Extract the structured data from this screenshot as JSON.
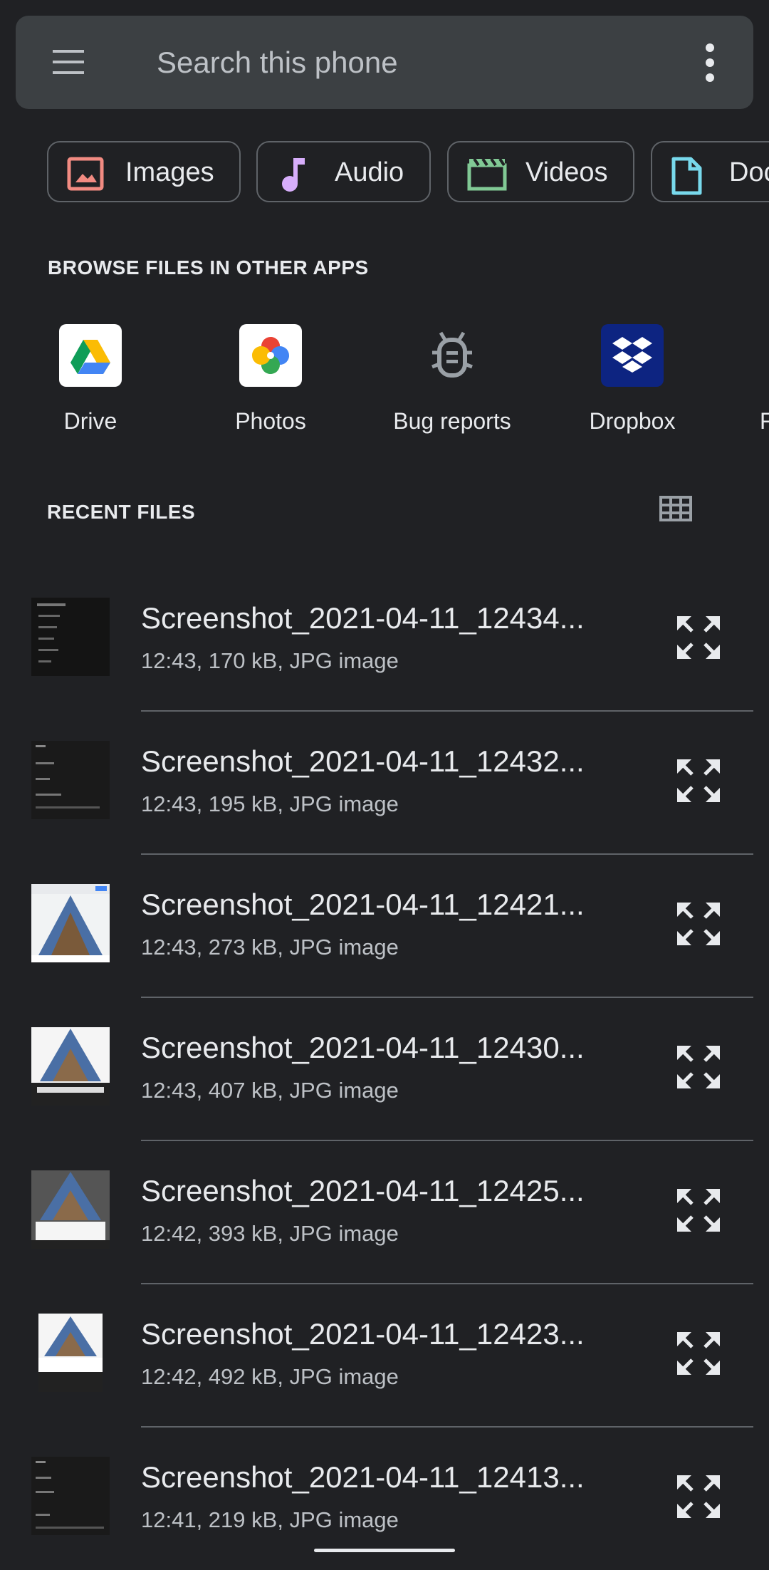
{
  "search": {
    "placeholder": "Search this phone"
  },
  "categories": [
    {
      "label": "Images",
      "color": "#f28b82"
    },
    {
      "label": "Audio",
      "color": "#d7aefb"
    },
    {
      "label": "Videos",
      "color": "#81c995"
    },
    {
      "label": "Documents",
      "color": "#78d9ec"
    }
  ],
  "browse": {
    "title": "BROWSE FILES IN OTHER APPS",
    "apps": [
      {
        "label": "Drive",
        "icon": "google-drive-icon"
      },
      {
        "label": "Photos",
        "icon": "google-photos-icon"
      },
      {
        "label": "Bug reports",
        "icon": "bug-icon"
      },
      {
        "label": "Dropbox",
        "icon": "dropbox-icon"
      },
      {
        "label": "F",
        "icon": "app-icon"
      }
    ]
  },
  "recent": {
    "title": "RECENT FILES",
    "files": [
      {
        "name": "Screenshot_2021-04-11_12434...",
        "meta": "12:43, 170 kB, JPG image"
      },
      {
        "name": "Screenshot_2021-04-11_12432...",
        "meta": "12:43, 195 kB, JPG image"
      },
      {
        "name": "Screenshot_2021-04-11_12421...",
        "meta": "12:43, 273 kB, JPG image"
      },
      {
        "name": "Screenshot_2021-04-11_12430...",
        "meta": "12:43, 407 kB, JPG image"
      },
      {
        "name": "Screenshot_2021-04-11_12425...",
        "meta": "12:42, 393 kB, JPG image"
      },
      {
        "name": "Screenshot_2021-04-11_12423...",
        "meta": "12:42, 492 kB, JPG image"
      },
      {
        "name": "Screenshot_2021-04-11_12413...",
        "meta": "12:41, 219 kB, JPG image"
      }
    ]
  }
}
